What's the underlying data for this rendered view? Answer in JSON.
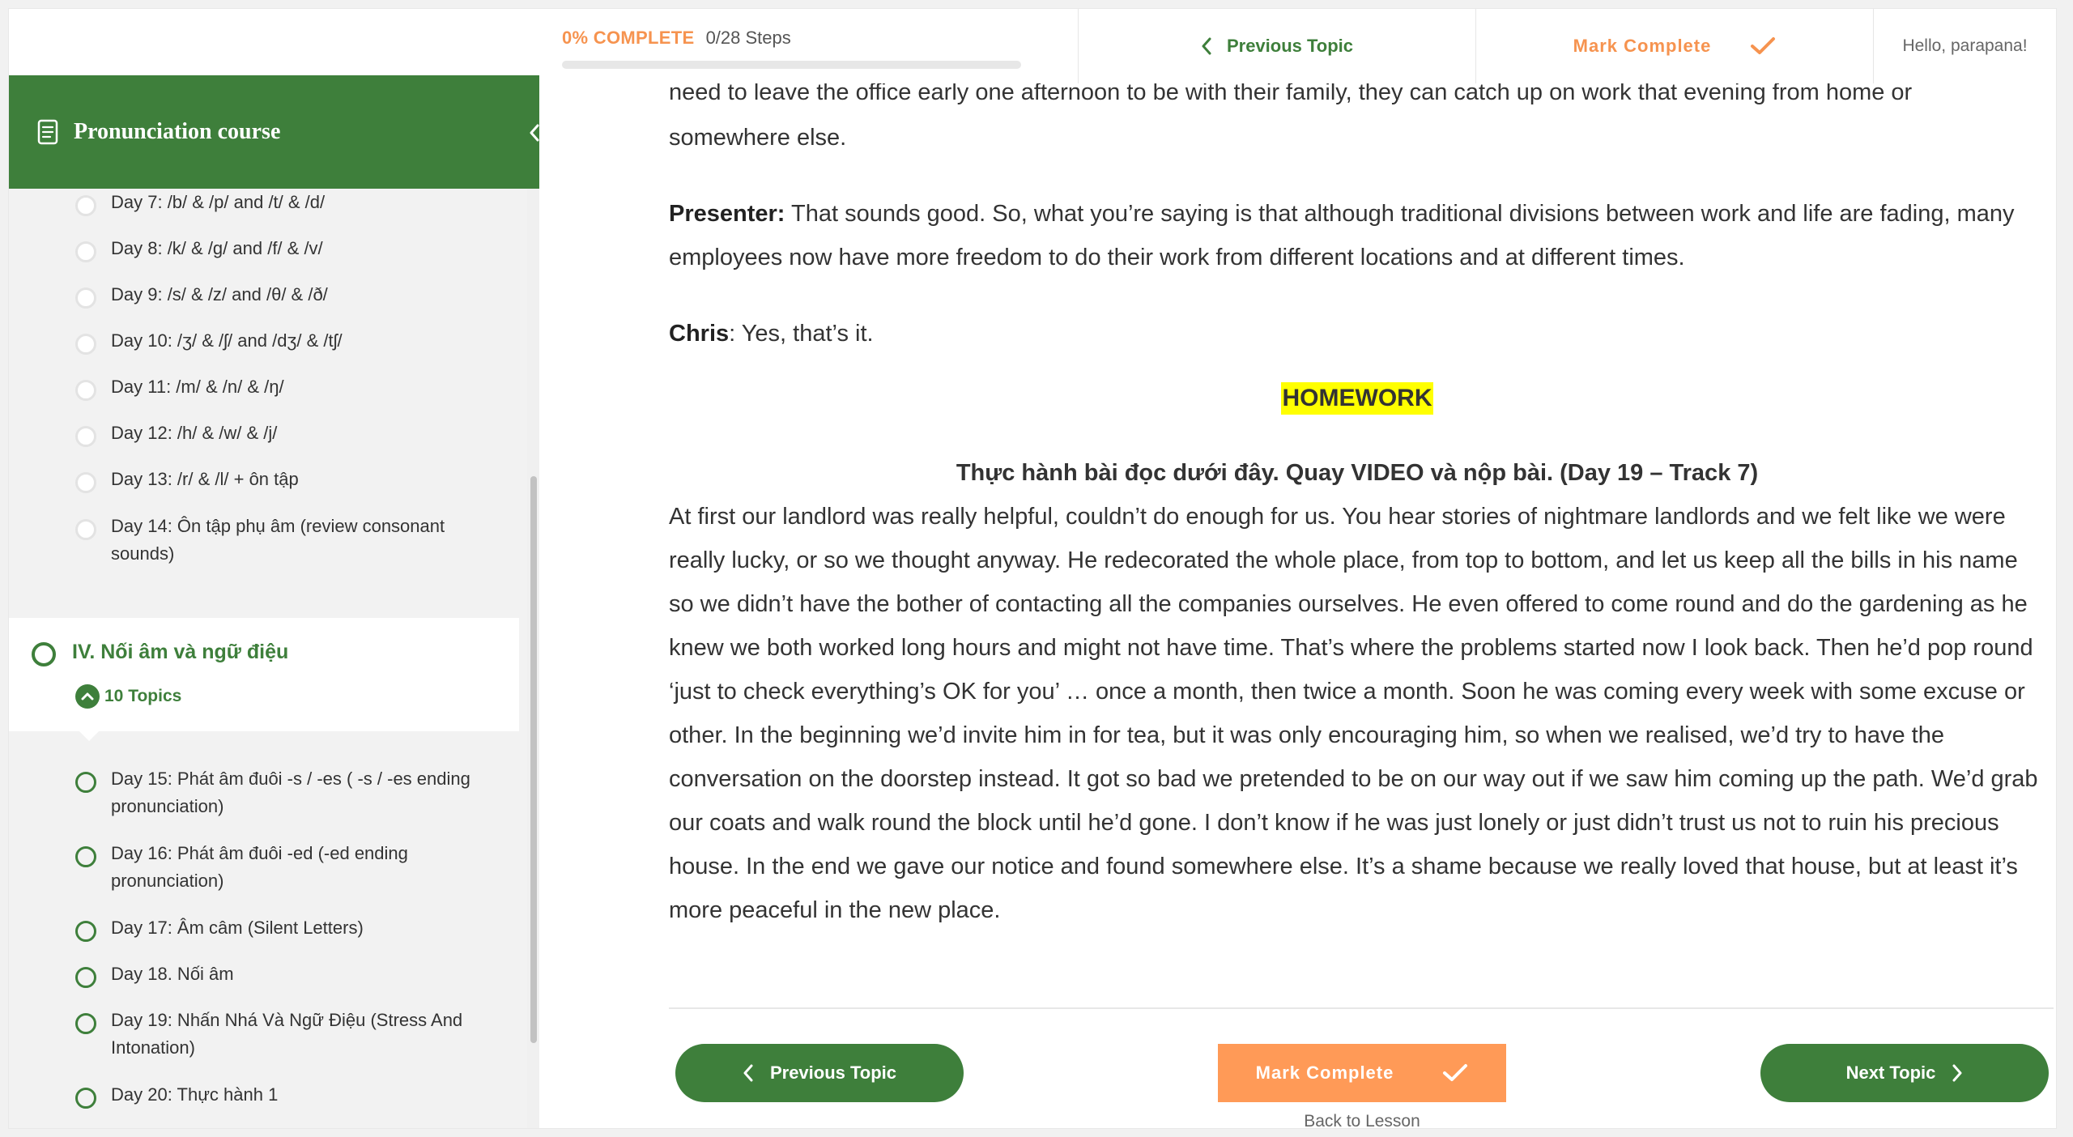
{
  "topbar": {
    "progress_percent_label": "0% COMPLETE",
    "steps_label": "0/28 Steps",
    "progress_fraction": 0,
    "previous_topic": "Previous Topic",
    "mark_complete": "Mark Complete",
    "greeting": "Hello, parapana!"
  },
  "sidebar": {
    "course_title": "Pronunciation course",
    "topics_before": [
      {
        "label": "Day 7: /b/ & /p/ and /t/ & /d/"
      },
      {
        "label": "Day 8: /k/ & /g/ and /f/ & /v/"
      },
      {
        "label": "Day 9: /s/ & /z/ and /θ/ & /ð/"
      },
      {
        "label": "Day 10: /ʒ/ & /ʃ/ and /dʒ/ & /tʃ/"
      },
      {
        "label": "Day 11: /m/ & /n/ & /ŋ/"
      },
      {
        "label": "Day 12: /h/ & /w/ & /j/"
      },
      {
        "label": "Day 13: /r/ & /l/ + ôn tập"
      },
      {
        "label": "Day 14: Ôn tập phụ âm (review consonant sounds)"
      }
    ],
    "section": {
      "title": "IV. Nối âm và ngữ điệu",
      "topics_count": "10 Topics"
    },
    "topics_after": [
      {
        "label": "Day 15: Phát âm đuôi -s / -es ( -s / -es ending pronunciation)"
      },
      {
        "label": "Day 16: Phát âm đuôi -ed (-ed ending pronunciation)"
      },
      {
        "label": "Day 17: Âm câm (Silent Letters)"
      },
      {
        "label": "Day 18. Nối âm"
      },
      {
        "label": "Day 19: Nhấn Nhá Và Ngữ Điệu (Stress And Intonation)"
      },
      {
        "label": "Day 20: Thực hành 1"
      }
    ]
  },
  "article": {
    "cut_top_line": "need to leave the office early one afternoon to be with their family, they can catch up on work that evening from home or",
    "line_2": "somewhere else.",
    "presenter_name": "Presenter:",
    "presenter_text": "That sounds good. So, what you’re saying is that although traditional divisions between work and life are fading, many employees now have more freedom to do their work from different locations and at different times.",
    "chris_name": "Chris",
    "chris_text": ": Yes, that’s it.",
    "homework_label": "HOMEWORK",
    "instruction": "Thực hành bài đọc dưới đây. Quay VIDEO và nộp bài. (Day 19 – Track 7)",
    "reading": "At first our landlord was really helpful, couldn’t do enough for us. You hear stories of nightmare landlords and we felt like we were really lucky, or so we thought anyway. He redecorated the whole place, from top to bottom, and let us keep all the bills in his name so we didn’t have the bother of contacting all the companies ourselves. He even offered to come round and do the gardening as he knew we both worked long hours and might not have time. That’s where the problems started now I look back. Then he’d pop round ‘just to check everything’s OK for you’ … once a month, then twice a month. Soon he was coming every week with some excuse or other. In the beginning we’d invite him in for tea, but it was only encouraging him, so when we realised, we’d try to have the conversation on the doorstep instead. It got so bad we pretended to be on our way out if we saw him coming up the path. We’d grab our coats and walk round the block until he’d gone. I don’t know if he was just lonely or just didn’t trust us not to ruin his precious house. In the end we gave our notice and found somewhere else. It’s a shame because we really loved that house, but at least it’s more peaceful in the new place."
  },
  "footer": {
    "previous_topic": "Previous Topic",
    "mark_complete": "Mark Complete",
    "next_topic": "Next Topic",
    "back_to_lesson": "Back to Lesson"
  },
  "colors": {
    "green": "#3e7f3b",
    "orange": "#f6934f",
    "homework_highlight": "#ffff00"
  },
  "icons": {
    "course_doc": "document-icon",
    "collapse": "chevron-left-icon",
    "prev": "chevron-left-icon",
    "check": "check-icon",
    "next": "chevron-right-icon",
    "expand": "chevron-up-icon"
  }
}
